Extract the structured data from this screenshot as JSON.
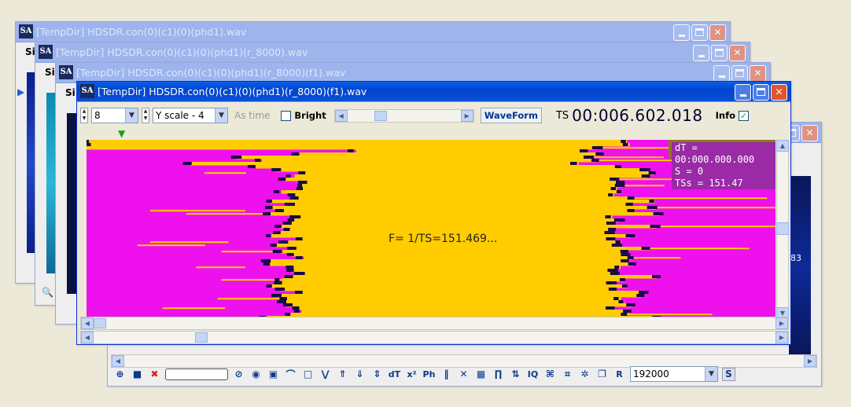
{
  "windows": {
    "w1": {
      "title": "[TempDir] HDSDR.con(0)(c1)(0)(phd1).wav",
      "menu_fragment": "Si"
    },
    "w2": {
      "title": "[TempDir] HDSDR.con(0)(c1)(0)(phd1)(r_8000).wav",
      "menu_fragment": "Si"
    },
    "w3": {
      "title": "[TempDir] HDSDR.con(0)(c1)(0)(phd1)(r_8000)(f1).wav",
      "menu_fragment": "Si"
    },
    "main": {
      "title": "[TempDir] HDSDR.con(0)(c1)(0)(phd1)(r_8000)(f1).wav"
    }
  },
  "icons": {
    "app": "SA",
    "minimize": "minimize-icon",
    "maximize": "maximize-icon",
    "close": "close-icon"
  },
  "toolbar": {
    "count_value": "8",
    "yscale_value": "Y scale - 4",
    "as_time_label": "As time",
    "bright_label": "Bright",
    "waveform_label": "WaveForm",
    "ts_label": "TS",
    "ts_value": "00:006.602.018",
    "info_label": "Info",
    "info_checked": "✓"
  },
  "spectrogram": {
    "info_lines": [
      "dT = 00:000.000.000",
      "S = 0",
      "TSs = 151.47"
    ],
    "center_text": "F= 1/TS=151.469...",
    "colors": {
      "background": "#ee11ee",
      "band": "#ffcc00",
      "edge": "#1a0a4a"
    }
  },
  "back_window_fragment": "83",
  "bottom_toolbar": {
    "rate_value": "192000",
    "tools": [
      "zoom-in-icon",
      "block-icon",
      "cancel-x-icon",
      "input-box",
      "no-icon",
      "speaker-icon",
      "square-icon",
      "arc-icon",
      "box-icon",
      "v-icon",
      "up-arrows-icon",
      "down-arrows-icon",
      "both-arrows-icon",
      "dT",
      "x²",
      "Ph",
      "bars-icon",
      "cross-icon",
      "grid-icon",
      "wave-icon",
      "updown-icon",
      "IQ",
      "loop-icon",
      "loop2-icon",
      "gear-icon",
      "copy-icon",
      "R"
    ],
    "s_label": "S"
  }
}
